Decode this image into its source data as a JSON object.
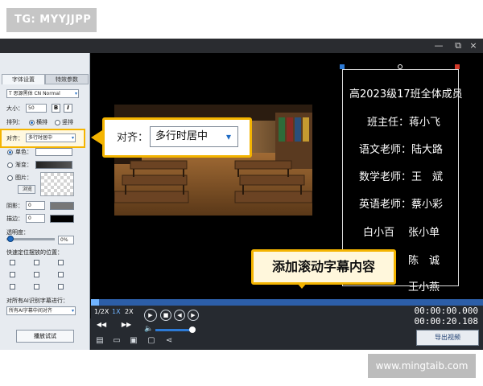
{
  "watermark_tag": "TG: MYYJJPP",
  "site_tag": "www.mingtaib.com",
  "window_controls": [
    "×",
    "⧉",
    "—"
  ],
  "left_panel": {
    "tabs": [
      "字体设置",
      "特效参数"
    ],
    "font_name": "T 思源黑体 CN Normal",
    "size_label": "大小：",
    "size_value": "50",
    "bold_label": "B",
    "italic_label": "I",
    "layout_label": "排列：",
    "layout_horizontal": "横排",
    "layout_vertical": "竖排",
    "align_label": "对齐：",
    "align_value": "多行时居中",
    "solid_label": "单色：",
    "gradient_label": "渐变：",
    "image_label": "图片：",
    "browse_label": "浏览",
    "shadow_label": "阴影：",
    "shadow_value": "0",
    "stroke_label": "描边：",
    "stroke_value": "0",
    "opacity_label": "透明度：",
    "opacity_value": "0%",
    "position_label": "快速定位摆放的位置：",
    "ai_label": "对所有AI识别字幕进行：",
    "ai_value": "所有AI字幕中间对齐",
    "test_button": "播放试试",
    "text_color": "#ffffff",
    "stroke_color": "#000000"
  },
  "callout": {
    "label": "对齐：",
    "value": "多行时居中"
  },
  "scroll_callout": "添加滚动字幕内容",
  "credits": [
    "高2023级17班全体成员",
    "班主任：蒋小飞",
    "语文老师：陆大路",
    "数学老师：王　斌",
    "英语老师：蔡小彩",
    "白小百",
    "张小单",
    "陈　诚",
    "王小燕"
  ],
  "playback": {
    "speeds": [
      "1/2X",
      "1X",
      "2X"
    ],
    "time_current": "00:00:00.000",
    "time_total": "00:00:20.108",
    "export_label": "导出视频"
  },
  "colors": {
    "accent": "#f4b400",
    "brand_blue": "#2c5ea8",
    "app_bg": "#1b1d21"
  }
}
